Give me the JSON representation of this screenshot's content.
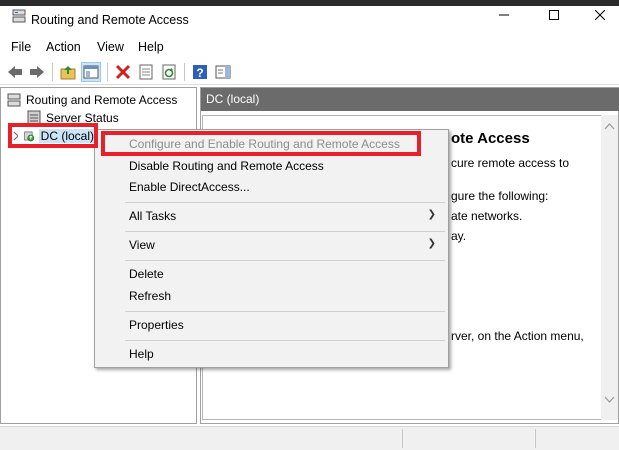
{
  "window": {
    "title": "Routing and Remote Access",
    "minimize_icon": "minimize-icon",
    "maximize_icon": "maximize-icon",
    "close_icon": "close-icon"
  },
  "menubar": {
    "items": [
      "File",
      "Action",
      "View",
      "Help"
    ]
  },
  "toolbar": {
    "icons": [
      "back-arrow-icon",
      "forward-arrow-icon",
      "up-folder-icon",
      "show-hide-console-tree-icon",
      "delete-icon",
      "properties-icon",
      "refresh-icon",
      "help-icon",
      "action-pane-icon"
    ]
  },
  "tree": {
    "root": "Routing and Remote Access",
    "server_status": "Server Status",
    "dc_node": "DC (local)"
  },
  "right_pane": {
    "header": "DC (local)",
    "heading": "ote Access",
    "lines": [
      "cure remote access to",
      "gure the following:",
      "ate networks.",
      "ay.",
      "rver, on the Action menu,"
    ]
  },
  "context_menu": {
    "items": {
      "configure": "Configure and Enable Routing and Remote Access",
      "disable": "Disable Routing and Remote Access",
      "directaccess": "Enable DirectAccess...",
      "all_tasks": "All Tasks",
      "view": "View",
      "delete": "Delete",
      "refresh": "Refresh",
      "properties": "Properties",
      "help": "Help"
    }
  },
  "colors": {
    "highlight_red": "#e8202a",
    "header_gray": "#6b6b6b"
  }
}
